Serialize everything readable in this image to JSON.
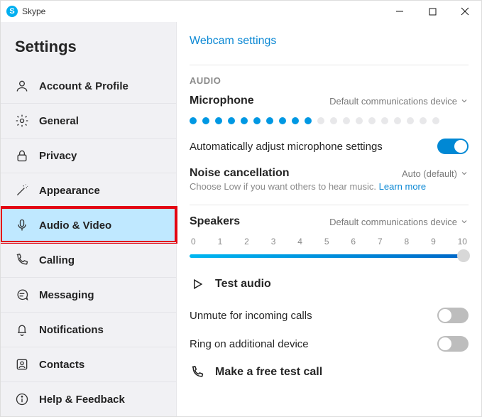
{
  "titlebar": {
    "title": "Skype"
  },
  "sidebar": {
    "title": "Settings",
    "items": [
      {
        "label": "Account & Profile"
      },
      {
        "label": "General"
      },
      {
        "label": "Privacy"
      },
      {
        "label": "Appearance"
      },
      {
        "label": "Audio & Video"
      },
      {
        "label": "Calling"
      },
      {
        "label": "Messaging"
      },
      {
        "label": "Notifications"
      },
      {
        "label": "Contacts"
      },
      {
        "label": "Help & Feedback"
      }
    ]
  },
  "content": {
    "webcam_link": "Webcam settings",
    "audio_section": "AUDIO",
    "microphone": {
      "title": "Microphone",
      "device": "Default communications device",
      "level_active": 10,
      "level_total": 20
    },
    "auto_adjust": {
      "label": "Automatically adjust microphone settings",
      "on": true
    },
    "noise": {
      "title": "Noise cancellation",
      "value": "Auto (default)",
      "subtitle_prefix": "Choose Low if you want others to hear music. ",
      "learn_more": "Learn more"
    },
    "speakers": {
      "title": "Speakers",
      "device": "Default communications device",
      "ticks": [
        "0",
        "1",
        "2",
        "3",
        "4",
        "5",
        "6",
        "7",
        "8",
        "9",
        "10"
      ],
      "value": 10
    },
    "test_audio": "Test audio",
    "unmute": {
      "label": "Unmute for incoming calls",
      "on": false
    },
    "ring_additional": {
      "label": "Ring on additional device",
      "on": false
    },
    "free_call": "Make a free test call"
  }
}
